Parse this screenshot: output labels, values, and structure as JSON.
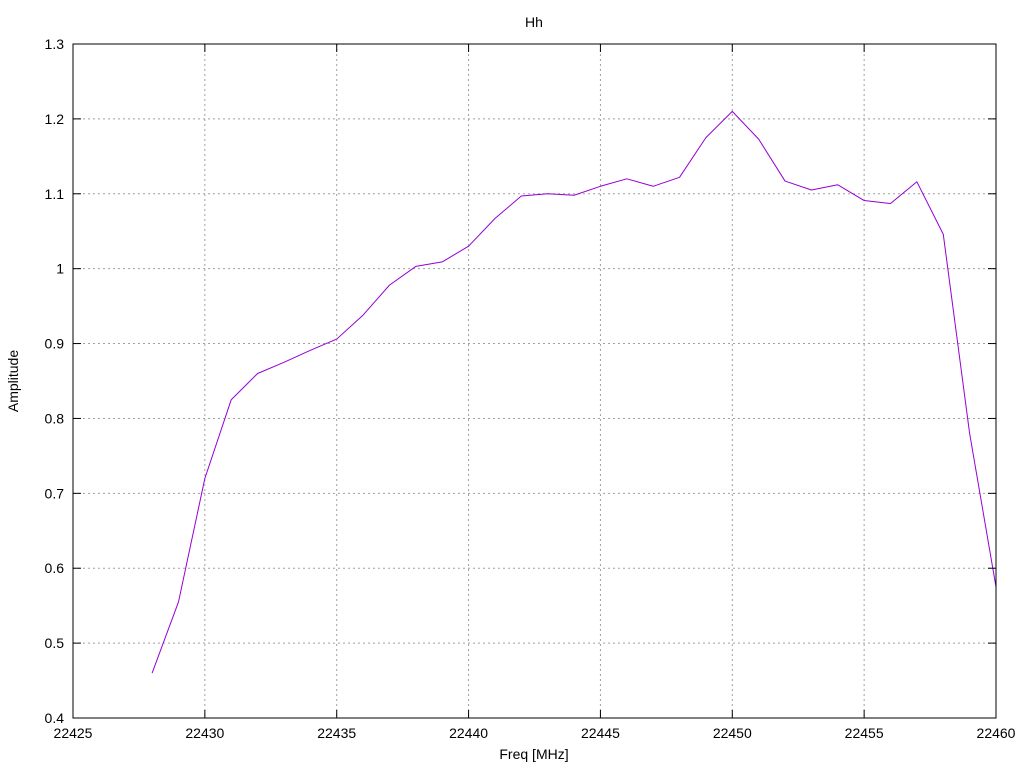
{
  "chart_data": {
    "type": "line",
    "title": "Hh",
    "xlabel": "Freq [MHz]",
    "ylabel": "Amplitude",
    "xlim": [
      22425,
      22460
    ],
    "ylim": [
      0.4,
      1.3
    ],
    "xticks": [
      22425,
      22430,
      22435,
      22440,
      22445,
      22450,
      22455,
      22460
    ],
    "yticks": [
      0.4,
      0.5,
      0.6,
      0.7,
      0.8,
      0.9,
      1,
      1.1,
      1.2,
      1.3
    ],
    "xtick_labels": [
      "22425",
      "22430",
      "22435",
      "22440",
      "22445",
      "22450",
      "22455",
      "22460"
    ],
    "ytick_labels": [
      "0.4",
      "0.5",
      "0.6",
      "0.7",
      "0.8",
      "0.9",
      "1",
      "1.1",
      "1.2",
      "1.3"
    ],
    "grid": true,
    "series": [
      {
        "color": "#9400d3",
        "x": [
          22428,
          22429,
          22430,
          22431,
          22432,
          22433,
          22434,
          22435,
          22436,
          22437,
          22438,
          22439,
          22440,
          22441,
          22442,
          22443,
          22444,
          22445,
          22446,
          22447,
          22448,
          22449,
          22450,
          22451,
          22452,
          22453,
          22454,
          22455,
          22456,
          22457,
          22458,
          22459,
          22460
        ],
        "y": [
          0.46,
          0.555,
          0.72,
          0.825,
          0.86,
          0.875,
          0.891,
          0.906,
          0.938,
          0.978,
          1.003,
          1.009,
          1.03,
          1.067,
          1.097,
          1.1,
          1.098,
          1.11,
          1.12,
          1.11,
          1.122,
          1.175,
          1.21,
          1.173,
          1.117,
          1.105,
          1.112,
          1.091,
          1.087,
          1.116,
          1.046,
          0.78,
          0.575
        ]
      }
    ]
  }
}
